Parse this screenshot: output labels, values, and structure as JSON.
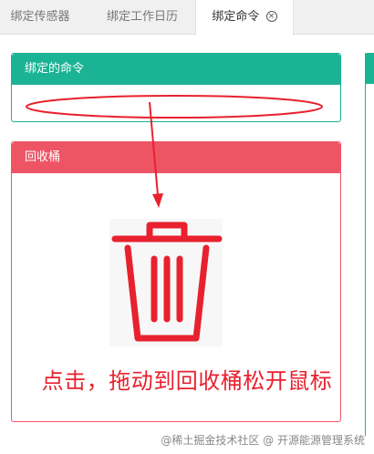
{
  "tabs": {
    "tab1": "绑定传感器",
    "tab2": "绑定工作日历",
    "tab3": "绑定命令",
    "close_glyph": "⊗"
  },
  "command_panel": {
    "title": "绑定的命令"
  },
  "bin_panel": {
    "title": "回收桶",
    "caption": "点击，拖动到回收桶松开鼠标",
    "icon": "trash-bin-icon"
  },
  "watermark": "@稀土掘金技术社区 @ 开源能源管理系统",
  "colors": {
    "green": "#1ab394",
    "red_header": "#ed5565",
    "annotation_red": "#e8212e"
  }
}
